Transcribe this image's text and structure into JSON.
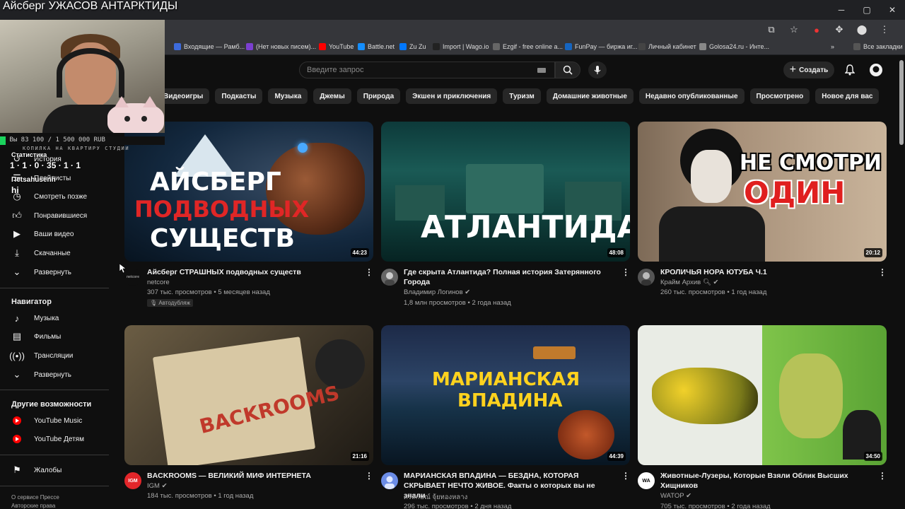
{
  "stream": {
    "title": "Айсберг УЖАСОВ АНТАРКТИДЫ",
    "donate_text": "Вы  83 100 / 1 500 000 RUB",
    "donate_sub": "КОПИЛКА НА КВАРТИРУ СТУДИИ",
    "stats_title": "Статистика",
    "stats_values": "1 · 1 · 0 · 35 · 1 · 1",
    "stats_user": "Пetsahusenh",
    "stats_hi": "hi"
  },
  "browser": {
    "bookmarks": [
      {
        "label": "Входящие — Рамб...",
        "color": "#3d6bdc"
      },
      {
        "label": "(Нет новых писем)...",
        "color": "#7b3fd0"
      },
      {
        "label": "YouTube",
        "color": "#ff0000"
      },
      {
        "label": "Battle.net",
        "color": "#148eff"
      },
      {
        "label": "Zu Zu",
        "color": "#0077ff"
      },
      {
        "label": "Import | Wago.io",
        "color": "#222222"
      },
      {
        "label": "Ezgif - free online a...",
        "color": "#666666"
      },
      {
        "label": "FunPay — биржа иг...",
        "color": "#1565c0"
      },
      {
        "label": "Личный кабинет",
        "color": "#444444"
      },
      {
        "label": "Golosa24.ru - Инте...",
        "color": "#888888"
      },
      {
        "label": "Все закладки",
        "color": "#555555"
      }
    ]
  },
  "header": {
    "search_placeholder": "Введите запрос",
    "create_label": "Создать"
  },
  "chips": [
    "Видеоигры",
    "Подкасты",
    "Музыка",
    "Джемы",
    "Природа",
    "Экшен и приключения",
    "Туризм",
    "Домашние животные",
    "Недавно опубликованные",
    "Просмотрено",
    "Новое для вас"
  ],
  "sidebar": {
    "items_top": [
      {
        "label": "История",
        "icon": "history-icon"
      },
      {
        "label": "Плейлисты",
        "icon": "playlists-icon"
      },
      {
        "label": "Смотреть позже",
        "icon": "watch-later-icon"
      },
      {
        "label": "Понравившиеся",
        "icon": "like-icon"
      },
      {
        "label": "Ваши видео",
        "icon": "your-videos-icon"
      },
      {
        "label": "Скачанные",
        "icon": "downloads-icon"
      },
      {
        "label": "Развернуть",
        "icon": "chevron-down-icon"
      }
    ],
    "nav_title": "Навигатор",
    "nav_items": [
      {
        "label": "Музыка",
        "icon": "music-icon"
      },
      {
        "label": "Фильмы",
        "icon": "film-icon"
      },
      {
        "label": "Трансляции",
        "icon": "live-icon"
      },
      {
        "label": "Развернуть",
        "icon": "chevron-down-icon"
      }
    ],
    "other_title": "Другие возможности",
    "other_items": [
      {
        "label": "YouTube Music",
        "icon": "youtube-music-icon"
      },
      {
        "label": "YouTube Детям",
        "icon": "youtube-kids-icon"
      }
    ],
    "report_label": "Жалобы",
    "footer_line1": "О сервисе  Прессе",
    "footer_line2": "Авторские права"
  },
  "videos": [
    {
      "title": "Айсберг СТРАШНЫХ подводных существ",
      "channel": "netcore",
      "meta": "307 тыс. просмотров • 5 месяцев назад",
      "badge": "Автодубляж",
      "duration": "44:23",
      "thumb_lines": [
        "АЙСБЕРГ",
        "ПОДВОДНЫХ",
        "СУЩЕСТВ"
      ]
    },
    {
      "title": "Где скрыта Атлантида? Полная история Затерянного Города",
      "channel": "Владимир Логинов",
      "meta": "1,8 млн просмотров • 2 года назад",
      "duration": "48:08",
      "thumb_lines": [
        "АТЛАНТИДА"
      ]
    },
    {
      "title": "КРОЛИЧЬЯ НОРА ЮТУБА Ч.1",
      "channel": "Крайм Архив",
      "meta": "260 тыс. просмотров • 1 год назад",
      "duration": "20:12",
      "thumb_lines": [
        "НЕ СМОТРИ",
        "ОДИН"
      ]
    },
    {
      "title": "BACKROOMS — ВЕЛИКИЙ МИФ ИНТЕРНЕТА",
      "channel": "IGM",
      "meta": "184 тыс. просмотров • 1 год назад",
      "duration": "21:16",
      "avatar_text": "IGM",
      "thumb_lines": [
        "BACKROOMS"
      ]
    },
    {
      "title": "МАРИАНСКАЯ ВПАДИНА — БЕЗДНА, КОТОРАЯ СКРЫВАЕТ НЕЧТО ЖИВОЕ.  Факты о которых вы не знали",
      "channel": "ศิริลักษณ์ จุ้ยทองหลาง",
      "meta": "296 тыс. просмотров • 2 дня назад",
      "duration": "44:39",
      "thumb_lines": [
        "МАРИАНСКАЯ",
        "ВПАДИНА"
      ]
    },
    {
      "title": "Животные-Лузеры, Которые Взяли Облик Высших Хищников",
      "channel": "WATOP",
      "meta": "705 тыс. просмотров • 2 года назад",
      "duration": "34:50",
      "avatar_text": "WA",
      "thumb_lines": []
    }
  ]
}
